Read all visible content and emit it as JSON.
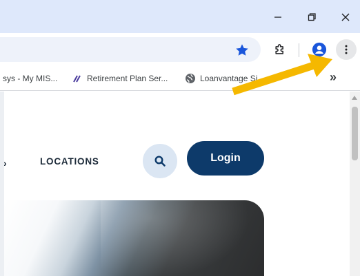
{
  "window_controls": {
    "minimize_icon": "minimize-icon",
    "maximize_icon": "restore-icon",
    "close_icon": "close-icon"
  },
  "toolbar": {
    "bookmark_star_icon": "star-icon",
    "extensions_icon": "puzzle-icon",
    "profile_icon": "profile-icon",
    "menu_icon": "three-dot-menu-icon"
  },
  "bookmarks": {
    "items": [
      {
        "label": "sys - My MIS...",
        "icon": "none"
      },
      {
        "label": "Retirement Plan Ser...",
        "icon": "slash-logo-icon"
      },
      {
        "label": "Loanvantage Si",
        "icon": "globe-icon"
      }
    ],
    "more_label": "»"
  },
  "page": {
    "nav_chevron": "›",
    "nav_locations": "LOCATIONS",
    "search_icon": "search-icon",
    "login_label": "Login"
  },
  "colors": {
    "titlebar": "#dee8fb",
    "login_bg": "#0d3a6a",
    "search_bg": "#dbe6f3",
    "star": "#1a56db",
    "arrow": "#f5b800"
  }
}
